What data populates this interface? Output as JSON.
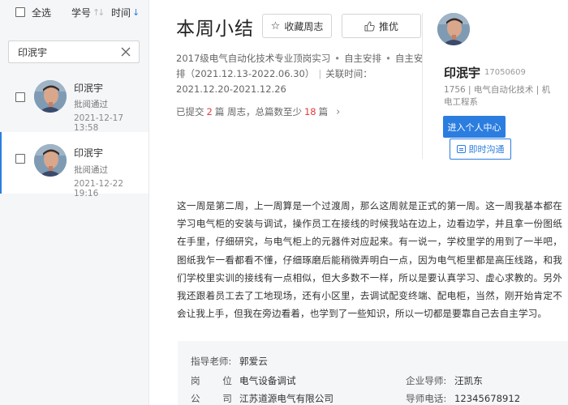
{
  "list": {
    "select_all": "全选",
    "sort_by_id": "学号",
    "sort_by_time": "时间",
    "search": {
      "value": "印泯宇"
    },
    "items": [
      {
        "name": "印泯宇",
        "status": "批阅通过",
        "date": "2021-12-17 13:58"
      },
      {
        "name": "印泯宇",
        "status": "批阅通过",
        "date": "2021-12-22 19:16"
      }
    ]
  },
  "header": {
    "title": "本周小结",
    "favorite_label": "收藏周志",
    "recommend_label": "推优",
    "meta": {
      "program": "2017级电气自动化技术专业顶岗实习",
      "type1": "自主安排",
      "type2": "自主安排",
      "period": "（2021.12.13-2022.06.30）",
      "related_label": "关联时间：",
      "related_time": "2021.12.20-2021.12.26"
    },
    "submit": {
      "prefix": "已提交",
      "submitted": "2",
      "unit1": "篇 周志，总篇数至少",
      "min": "18",
      "unit2": "篇"
    }
  },
  "student": {
    "name": "印泯宇",
    "id": "17050609",
    "info": "1756 | 电气自动化技术 | 机电工程系",
    "center_button": "进入个人中心",
    "chat_button": "即时沟通"
  },
  "content": "这一周是第二周，上一周算是一个过渡周，那么这周就是正式的第一周。这一周我基本都在学习电气柜的安装与调试，操作员工在接线的时候我站在边上，边看边学，并且拿一份图纸在手里，仔细研究，与电气柜上的元器件对应起来。有一说一，学校里学的用到了一半吧，图纸我乍一看都看不懂，仔细琢磨后能稍微弄明白一点，因为电气柜里都是高压线路，和我们学校里实训的接线有一点相似，但大多数不一样，所以是要认真学习、虚心求教的。另外我还跟着员工去了工地现场，还有小区里，去调试配变终端、配电柜，当然，刚开始肯定不会让我上手，但我在旁边看着，也学到了一些知识，所以一切都是要靠自己去自主学习。",
  "footer": {
    "teacher_label": "指导老师:",
    "teacher": "郭爱云",
    "position_label": "岗 位:",
    "position": "电气设备调试",
    "company_label": "公 司:",
    "company": "江苏道源电气有限公司",
    "mentor_label": "企业导师:",
    "mentor": "汪凯东",
    "phone_label": "导师电话:",
    "phone": "12345678912"
  },
  "colors": {
    "accent": "#2b7de0",
    "highlight": "#e23b3b",
    "panel": "#f5f6f8"
  }
}
